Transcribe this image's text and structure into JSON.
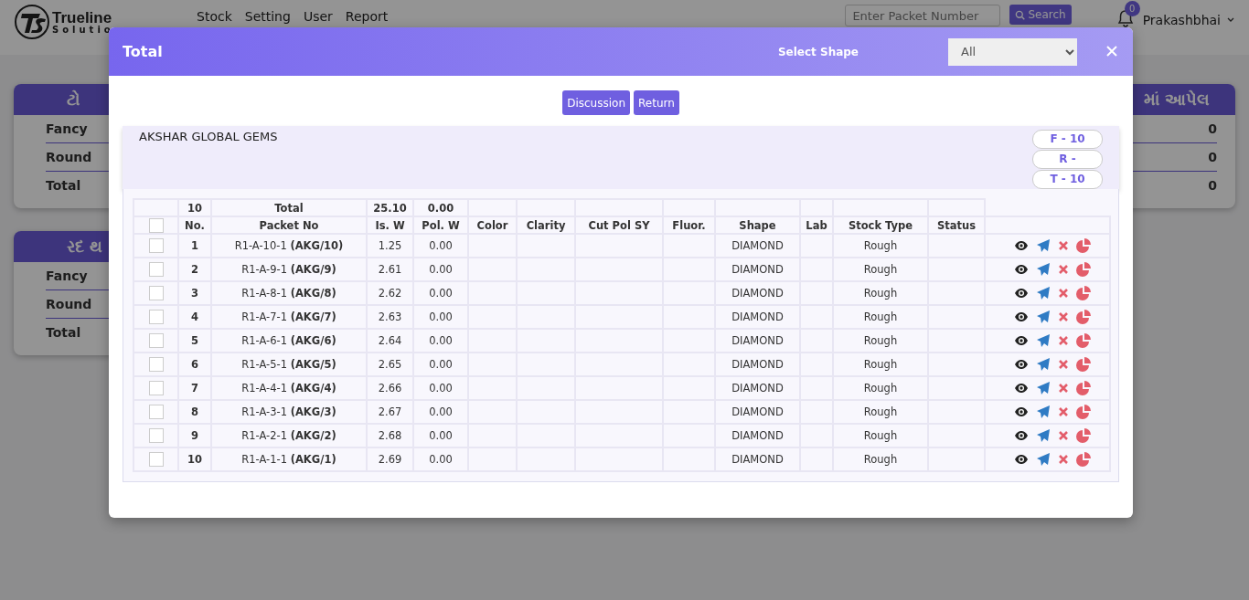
{
  "navbar": {
    "logo_text": "Trueline",
    "logo_subtext": "Solutio",
    "menu": [
      "Stock",
      "Setting",
      "User",
      "Report"
    ],
    "search": {
      "placeholder": "Enter Packet Number",
      "button": "Search"
    },
    "notifications": "0",
    "user": "Prakashbhai"
  },
  "left_cards": [
    {
      "title": "ટો",
      "rows": [
        {
          "label": "Fancy"
        },
        {
          "label": "Round"
        },
        {
          "label": "Total"
        }
      ]
    },
    {
      "title": "રદ થ",
      "rows": [
        {
          "label": "Fancy"
        },
        {
          "label": "Round"
        },
        {
          "label": "Total"
        }
      ]
    }
  ],
  "right_cards": [
    {
      "title": "માં આપેલ",
      "rows": [
        {
          "value": "0"
        },
        {
          "value": "0"
        },
        {
          "value": "0"
        }
      ]
    }
  ],
  "modal": {
    "title": "Total",
    "shape_label": "Select Shape",
    "shape_value": "All",
    "buttons": [
      "Discussion",
      "Return"
    ],
    "party": {
      "name": "AKSHAR GLOBAL GEMS",
      "pills": [
        "F - 10",
        "R -",
        "T - 10"
      ]
    },
    "totals": {
      "all_checked": false,
      "count": "10",
      "label": "Total",
      "is_w": "25.10",
      "pol_w": "0.00"
    },
    "columns": [
      "No.",
      "Packet No",
      "Is. W",
      "Pol. W",
      "Color",
      "Clarity",
      "Cut Pol SY",
      "Fluor.",
      "Shape",
      "Lab",
      "Stock Type",
      "Status"
    ],
    "rows": [
      {
        "checked": false,
        "no": "1",
        "packet": "R1-A-10-1 **(AKG/10)**",
        "is_w": "1.25",
        "pol_w": "0.00",
        "shape": "DIAMOND",
        "stock_type": "Rough"
      },
      {
        "checked": false,
        "no": "2",
        "packet": "R1-A-9-1 **(AKG/9)**",
        "is_w": "2.61",
        "pol_w": "0.00",
        "shape": "DIAMOND",
        "stock_type": "Rough"
      },
      {
        "checked": false,
        "no": "3",
        "packet": "R1-A-8-1 **(AKG/8)**",
        "is_w": "2.62",
        "pol_w": "0.00",
        "shape": "DIAMOND",
        "stock_type": "Rough"
      },
      {
        "checked": false,
        "no": "4",
        "packet": "R1-A-7-1 **(AKG/7)**",
        "is_w": "2.63",
        "pol_w": "0.00",
        "shape": "DIAMOND",
        "stock_type": "Rough"
      },
      {
        "checked": false,
        "no": "5",
        "packet": "R1-A-6-1 **(AKG/6)**",
        "is_w": "2.64",
        "pol_w": "0.00",
        "shape": "DIAMOND",
        "stock_type": "Rough"
      },
      {
        "checked": false,
        "no": "6",
        "packet": "R1-A-5-1 **(AKG/5)**",
        "is_w": "2.65",
        "pol_w": "0.00",
        "shape": "DIAMOND",
        "stock_type": "Rough"
      },
      {
        "checked": false,
        "no": "7",
        "packet": "R1-A-4-1 **(AKG/4)**",
        "is_w": "2.66",
        "pol_w": "0.00",
        "shape": "DIAMOND",
        "stock_type": "Rough"
      },
      {
        "checked": false,
        "no": "8",
        "packet": "R1-A-3-1 **(AKG/3)**",
        "is_w": "2.67",
        "pol_w": "0.00",
        "shape": "DIAMOND",
        "stock_type": "Rough"
      },
      {
        "checked": false,
        "no": "9",
        "packet": "R1-A-2-1 **(AKG/2)**",
        "is_w": "2.68",
        "pol_w": "0.00",
        "shape": "DIAMOND",
        "stock_type": "Rough"
      },
      {
        "checked": false,
        "no": "10",
        "packet": "R1-A-1-1 **(AKG/1)**",
        "is_w": "2.69",
        "pol_w": "0.00",
        "shape": "DIAMOND",
        "stock_type": "Rough"
      }
    ]
  }
}
